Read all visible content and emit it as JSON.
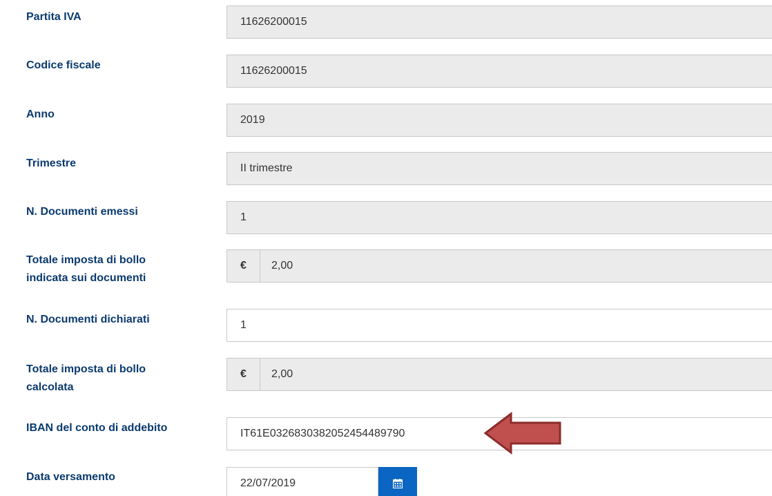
{
  "fields": [
    {
      "label": "Partita IVA",
      "value": "11626200015"
    },
    {
      "label": "Codice fiscale",
      "value": "11626200015"
    },
    {
      "label": "Anno",
      "value": "2019"
    },
    {
      "label": "Trimestre",
      "value": "II trimestre"
    },
    {
      "label": "N. Documenti emessi",
      "value": "1"
    },
    {
      "label_line1": "Totale imposta di bollo",
      "label_line2": "indicata sui documenti",
      "currency": "€",
      "value": "2,00"
    },
    {
      "label": "N. Documenti dichiarati",
      "value": "1"
    },
    {
      "label_line1": "Totale imposta di bollo",
      "label_line2": "calcolata",
      "currency": "€",
      "value": "2,00"
    },
    {
      "label": "IBAN del conto di addebito",
      "value": "IT61E0326830382052454489790"
    },
    {
      "label": "Data versamento",
      "value": "22/07/2019"
    }
  ],
  "icons": {
    "calendar": "calendar-icon",
    "arrow": "red-arrow-left-icon"
  },
  "colors": {
    "label": "#0b3a6e",
    "readonly_bg": "#ebebeb",
    "calendar_button": "#0a66c2",
    "arrow_fill": "#c0504d",
    "arrow_stroke": "#8c2b2b"
  }
}
